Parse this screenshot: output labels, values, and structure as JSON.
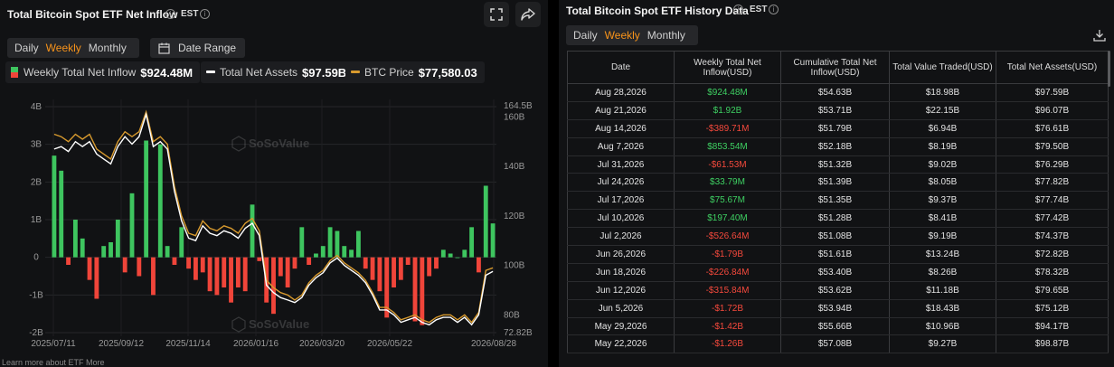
{
  "left": {
    "title": "Total Bitcoin Spot ETF Net Inflow",
    "timezone": "EST",
    "tabs": [
      "Daily",
      "Weekly",
      "Monthly"
    ],
    "active_tab": "Weekly",
    "date_range_label": "Date Range",
    "legend": [
      {
        "label": "Weekly Total Net Inflow",
        "value": "$924.48M"
      },
      {
        "label": "Total Net Assets",
        "value": "$97.59B"
      },
      {
        "label": "BTC Price",
        "value": "$77,580.03"
      }
    ],
    "watermark": "SoSoValue",
    "footer": "Learn more about ETF   More"
  },
  "right": {
    "title": "Total Bitcoin Spot ETF History Data",
    "timezone": "EST",
    "tabs": [
      "Daily",
      "Weekly",
      "Monthly"
    ],
    "active_tab": "Weekly",
    "columns": [
      "Date",
      "Weekly Total Net Inflow(USD)",
      "Cumulative Total Net Inflow(USD)",
      "Total Value Traded(USD)",
      "Total Net Assets(USD)"
    ],
    "rows": [
      [
        "Aug 28,2026",
        "$924.48M",
        "$54.63B",
        "$18.98B",
        "$97.59B"
      ],
      [
        "Aug 21,2026",
        "$1.92B",
        "$53.71B",
        "$22.15B",
        "$96.07B"
      ],
      [
        "Aug 14,2026",
        "-$389.71M",
        "$51.79B",
        "$6.94B",
        "$76.61B"
      ],
      [
        "Aug 7,2026",
        "$853.54M",
        "$52.18B",
        "$8.19B",
        "$79.50B"
      ],
      [
        "Jul 31,2026",
        "-$61.53M",
        "$51.32B",
        "$9.02B",
        "$76.29B"
      ],
      [
        "Jul 24,2026",
        "$33.79M",
        "$51.39B",
        "$8.05B",
        "$77.82B"
      ],
      [
        "Jul 17,2026",
        "$75.67M",
        "$51.35B",
        "$9.37B",
        "$77.74B"
      ],
      [
        "Jul 10,2026",
        "$197.40M",
        "$51.28B",
        "$8.41B",
        "$77.42B"
      ],
      [
        "Jul 2,2026",
        "-$526.64M",
        "$51.08B",
        "$9.19B",
        "$74.37B"
      ],
      [
        "Jun 26,2026",
        "-$1.79B",
        "$51.61B",
        "$13.24B",
        "$72.82B"
      ],
      [
        "Jun 18,2026",
        "-$226.84M",
        "$53.40B",
        "$8.26B",
        "$78.32B"
      ],
      [
        "Jun 12,2026",
        "-$315.84M",
        "$53.62B",
        "$11.18B",
        "$79.65B"
      ],
      [
        "Jun 5,2026",
        "-$1.72B",
        "$53.94B",
        "$18.43B",
        "$75.12B"
      ],
      [
        "May 29,2026",
        "-$1.42B",
        "$55.66B",
        "$10.96B",
        "$94.17B"
      ],
      [
        "May 22,2026",
        "-$1.26B",
        "$57.08B",
        "$9.27B",
        "$98.87B"
      ]
    ]
  },
  "chart_data": {
    "type": "bar",
    "x_tick_labels": [
      "2025/07/11",
      "2025/09/12",
      "2025/11/14",
      "2026/01/16",
      "2026/03/20",
      "2026/05/22",
      "2026/08/28"
    ],
    "y_left_ticks": [
      "4B",
      "3B",
      "2B",
      "1B",
      "0",
      "-1B",
      "-2B"
    ],
    "y_left_range": [
      -2,
      4
    ],
    "y_right_ticks": [
      "164.5B",
      "160B",
      "140B",
      "120B",
      "100B",
      "80B",
      "72.82B"
    ],
    "y_right_range": [
      72.82,
      164.5
    ],
    "grid": true,
    "colors": {
      "positive": "#3ec55f",
      "negative": "#f0453a",
      "net_assets": "#ffffff",
      "btc_price": "#d89a2e"
    },
    "series": [
      {
        "name": "Weekly Total Net Inflow",
        "unit": "B USD",
        "values": [
          2.7,
          2.3,
          -0.2,
          1.0,
          0.5,
          -0.6,
          -1.1,
          0.3,
          0.4,
          1.0,
          -0.4,
          1.7,
          -0.5,
          3.1,
          -1.0,
          3.0,
          0.3,
          -0.2,
          0.8,
          -0.3,
          -0.6,
          -0.4,
          -0.9,
          -1.0,
          -0.8,
          -1.2,
          -0.8,
          -0.9,
          1.4,
          -0.1,
          -1.2,
          -1.5,
          -0.5,
          -0.8,
          -0.3,
          0.8,
          -0.2,
          0.1,
          0.3,
          0.8,
          0.7,
          0.3,
          0.2,
          0.7,
          -0.3,
          -0.6,
          -0.9,
          -1.6,
          -0.8,
          -0.6,
          -0.2,
          -1.7,
          -1.8,
          -0.5,
          -0.3,
          0.2,
          0.1,
          0.0,
          0.2,
          0.8,
          -0.4,
          1.9,
          0.9
        ]
      },
      {
        "name": "Total Net Assets",
        "unit": "B USD",
        "values": [
          147,
          148,
          146,
          150,
          148,
          150,
          145,
          143,
          141,
          148,
          152,
          149,
          152,
          161,
          148,
          150,
          147,
          130,
          118,
          111,
          110,
          116,
          113,
          112,
          114,
          113,
          111,
          115,
          117,
          112,
          92,
          89,
          87,
          86,
          85,
          87,
          92,
          95,
          97,
          101,
          103,
          100,
          98,
          96,
          93,
          88,
          82,
          82,
          80,
          77,
          78,
          79,
          77,
          76,
          78,
          79,
          79,
          77,
          79,
          76,
          80,
          96,
          97.59
        ]
      },
      {
        "name": "BTC Price",
        "unit": "price",
        "values": [
          153,
          152,
          150,
          153,
          151,
          153,
          147,
          145,
          143,
          150,
          154,
          152,
          154,
          162,
          150,
          152,
          149,
          132,
          120,
          113,
          112,
          118,
          115,
          114,
          116,
          115,
          113,
          117,
          119,
          114,
          94,
          91,
          89,
          88,
          86,
          88,
          93,
          96,
          98,
          102,
          104,
          101,
          99,
          97,
          94,
          89,
          83,
          83,
          81,
          78,
          79,
          80,
          78,
          77,
          79,
          80,
          80,
          78,
          80,
          77,
          81,
          98,
          99
        ]
      }
    ]
  }
}
